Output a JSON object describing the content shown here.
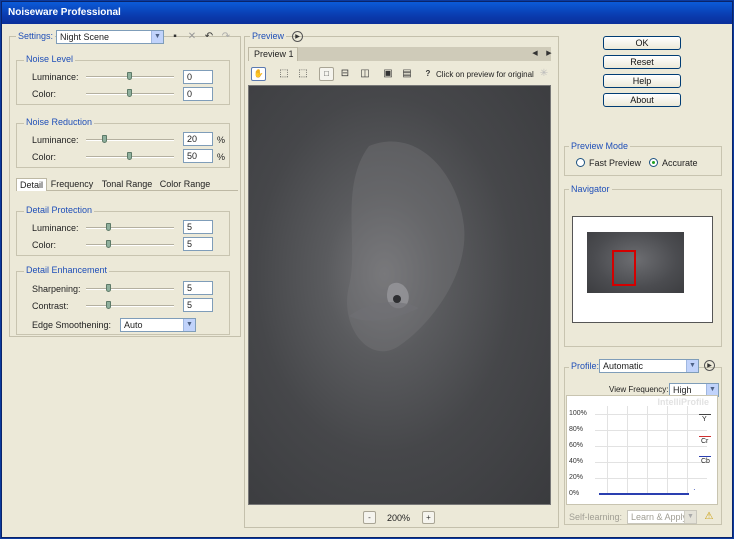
{
  "window": {
    "title": "Noiseware Professional"
  },
  "settings": {
    "label": "Settings:",
    "value": "Night Scene"
  },
  "noise_level": {
    "title": "Noise Level",
    "rows": [
      {
        "label": "Luminance:",
        "value": "0"
      },
      {
        "label": "Color:",
        "value": "0"
      }
    ]
  },
  "noise_reduction": {
    "title": "Noise Reduction",
    "rows": [
      {
        "label": "Luminance:",
        "value": "20",
        "unit": "%"
      },
      {
        "label": "Color:",
        "value": "50",
        "unit": "%"
      }
    ]
  },
  "tabs": [
    "Detail",
    "Frequency",
    "Tonal Range",
    "Color Range"
  ],
  "detail_protection": {
    "title": "Detail Protection",
    "rows": [
      {
        "label": "Luminance:",
        "value": "5"
      },
      {
        "label": "Color:",
        "value": "5"
      }
    ]
  },
  "detail_enhancement": {
    "title": "Detail Enhancement",
    "rows": [
      {
        "label": "Sharpening:",
        "value": "5"
      },
      {
        "label": "Contrast:",
        "value": "5"
      }
    ],
    "edge_smoothening_label": "Edge Smoothening:",
    "edge_smoothening_value": "Auto"
  },
  "preview": {
    "title": "Preview",
    "tab_label": "Preview 1",
    "hint": "Click on preview for original",
    "zoom": "200%",
    "zoom_out": "-",
    "zoom_in": "+"
  },
  "buttons": {
    "ok": "OK",
    "reset": "Reset",
    "help": "Help",
    "about": "About"
  },
  "preview_mode": {
    "title": "Preview Mode",
    "fast": "Fast Preview",
    "accurate": "Accurate",
    "selected": "accurate"
  },
  "navigator": {
    "title": "Navigator"
  },
  "profile": {
    "label": "Profile:",
    "value": "Automatic",
    "view_frequency_label": "View Frequency:",
    "view_frequency_value": "High",
    "watermark": "IntelliProfile",
    "y_ticks": [
      "100%",
      "80%",
      "60%",
      "40%",
      "20%",
      "0%"
    ],
    "legend": [
      "Y",
      "Cr",
      "Cb"
    ],
    "self_learning_label": "Self-learning:",
    "self_learning_value": "Learn & Apply"
  },
  "colors": {
    "title_bar": "#0a3cb0",
    "legend_blue": "#1f4fb8",
    "nav_rect": "#d40000",
    "y_line": "#444444",
    "cr_line": "#d03030",
    "cb_line": "#2a3fb0"
  }
}
